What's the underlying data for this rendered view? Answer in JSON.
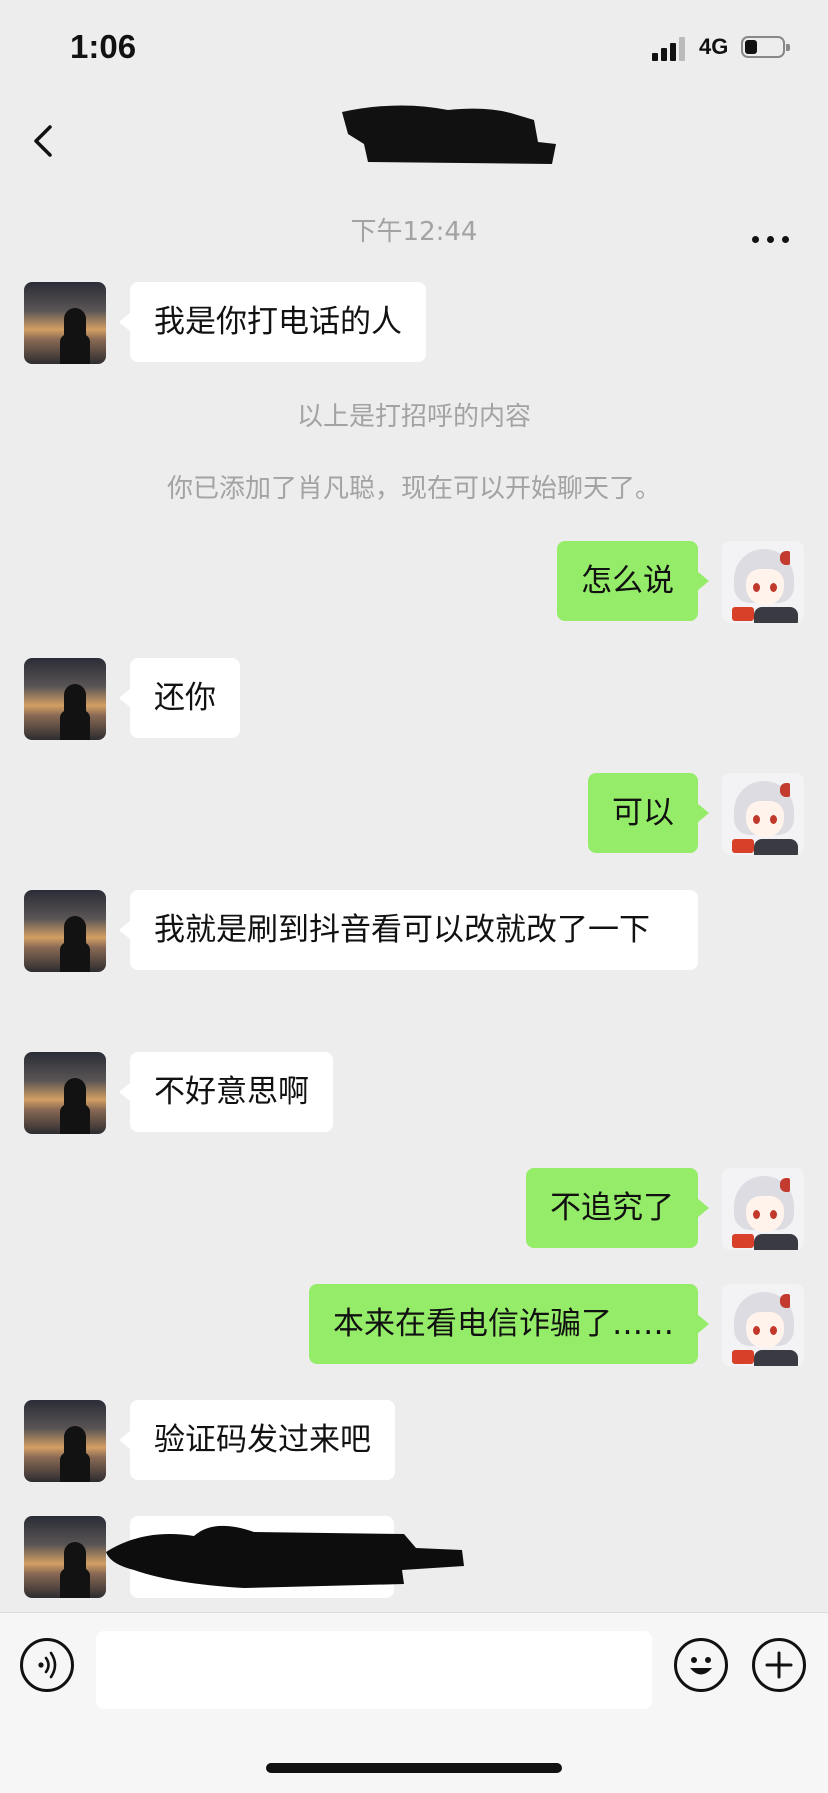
{
  "status_bar": {
    "time": "1:06",
    "network": "4G"
  },
  "nav": {
    "back_icon": "chevron-left-icon",
    "more_icon": "ellipsis-icon"
  },
  "chat": {
    "timestamp": "下午12:44",
    "system_messages": [
      "以上是打招呼的内容",
      "你已添加了肖凡聪，现在可以开始聊天了。"
    ],
    "messages": [
      {
        "side": "in",
        "text": "我是你打电话的人"
      },
      {
        "side": "out",
        "text": "怎么说"
      },
      {
        "side": "in",
        "text": "还你"
      },
      {
        "side": "out",
        "text": "可以"
      },
      {
        "side": "in",
        "text": "我就是刷到抖音看可以改就改了一下"
      },
      {
        "side": "in",
        "text": "不好意思啊"
      },
      {
        "side": "out",
        "text": "不追究了"
      },
      {
        "side": "out",
        "text": "本来在看电信诈骗了……"
      },
      {
        "side": "in",
        "text": "验证码发过来吧"
      },
      {
        "side": "in",
        "text": ""
      }
    ]
  },
  "input_bar": {
    "voice_icon": "voice-icon",
    "emoji_icon": "emoji-icon",
    "plus_icon": "plus-icon",
    "draft": ""
  },
  "colors": {
    "background": "#ededed",
    "outgoing_bubble": "#95ec69",
    "incoming_bubble": "#ffffff",
    "system_text": "#a3a3a3"
  }
}
